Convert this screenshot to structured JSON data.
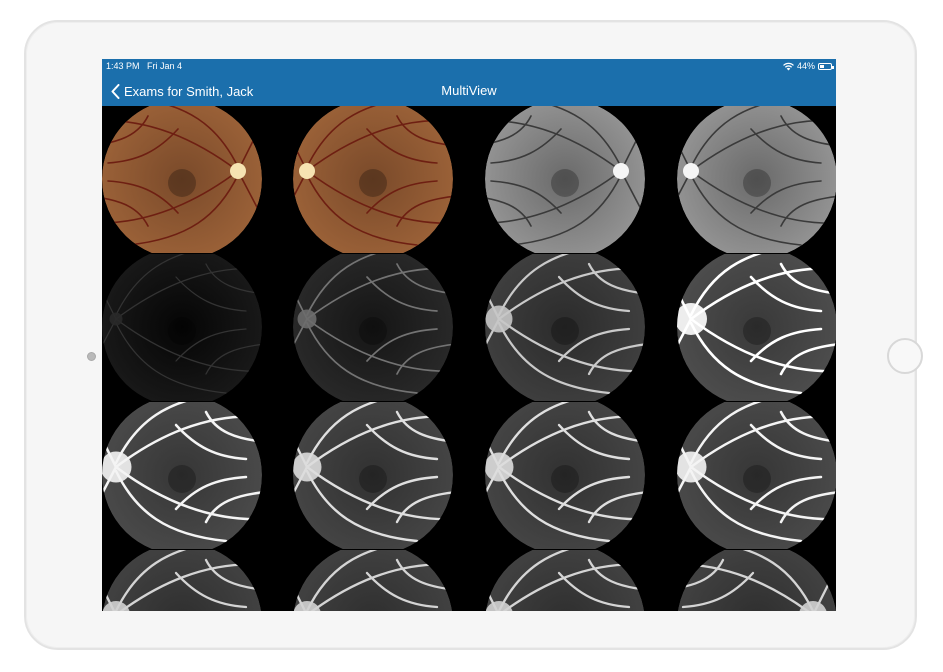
{
  "status_bar": {
    "time": "1:43 PM   Fri Jan 4",
    "battery_text": "44%",
    "battery_level": 0.44
  },
  "nav": {
    "back_label": "Exams for Smith, Jack",
    "title": "MultiView"
  },
  "images": [
    {
      "name": "fundus-color-left",
      "kind": "color",
      "disc": "right"
    },
    {
      "name": "fundus-color-right",
      "kind": "color",
      "disc": "left"
    },
    {
      "name": "fundus-redfree-left",
      "kind": "gray",
      "disc": "right"
    },
    {
      "name": "fundus-redfree-right",
      "kind": "gray",
      "disc": "left"
    },
    {
      "name": "fa-frame-1",
      "kind": "fa",
      "brightness": 0.05,
      "disc": "left"
    },
    {
      "name": "fa-frame-2",
      "kind": "fa",
      "brightness": 0.35,
      "disc": "left"
    },
    {
      "name": "fa-frame-3",
      "kind": "fa",
      "brightness": 0.75,
      "disc": "left"
    },
    {
      "name": "fa-frame-4",
      "kind": "fa",
      "brightness": 1.0,
      "disc": "left"
    },
    {
      "name": "fa-frame-5",
      "kind": "fa",
      "brightness": 0.95,
      "disc": "left"
    },
    {
      "name": "fa-frame-6",
      "kind": "fa",
      "brightness": 0.85,
      "disc": "left"
    },
    {
      "name": "fa-frame-7",
      "kind": "fa",
      "brightness": 0.85,
      "disc": "left"
    },
    {
      "name": "fa-frame-8",
      "kind": "fa",
      "brightness": 0.95,
      "disc": "left"
    },
    {
      "name": "fa-frame-9",
      "kind": "fa",
      "brightness": 0.8,
      "disc": "left"
    },
    {
      "name": "fa-frame-10",
      "kind": "fa",
      "brightness": 0.8,
      "disc": "left"
    },
    {
      "name": "fa-frame-11",
      "kind": "fa",
      "brightness": 0.8,
      "disc": "left"
    },
    {
      "name": "fa-frame-12",
      "kind": "fa",
      "brightness": 0.8,
      "disc": "right"
    }
  ],
  "colors": {
    "nav_bar": "#1b6fac",
    "screen_bg": "#000000"
  },
  "icons": {
    "back": "chevron-left-icon",
    "wifi": "wifi-icon",
    "battery": "battery-icon"
  }
}
